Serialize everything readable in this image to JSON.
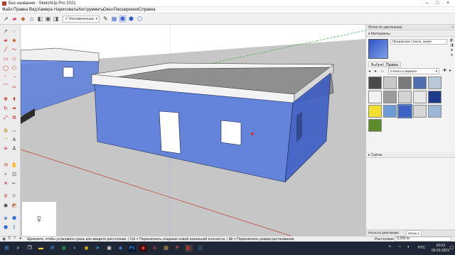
{
  "window": {
    "title": "Без названия - SketchUp Pro 2021",
    "controls": [
      "minimize-icon",
      "maximize-icon",
      "close-icon"
    ]
  },
  "menu": [
    "Файл",
    "Правка",
    "Вид",
    "Камера",
    "Нарисовать",
    "Инструменты",
    "Окно",
    "Расширения",
    "Справка"
  ],
  "toolbar": {
    "layer_label": "Непомеченные",
    "icons": [
      "select-icon",
      "eraser-icon",
      "paint-bucket-icon",
      "home-icon",
      "cube-icon",
      "box-front-icon",
      "box-right-icon",
      "box-back-icon",
      "box-left-icon",
      "pencil-icon",
      "xray-icon",
      "wireframe-icon",
      "shaded-icon",
      "textured-icon"
    ]
  },
  "left_tools": [
    "select-icon",
    "lasso-icon",
    "eraser-icon",
    "paint-bucket-icon",
    "line-icon",
    "freehand-icon",
    "rectangle-icon",
    "rotated-rectangle-icon",
    "circle-icon",
    "polygon-icon",
    "arc-icon",
    "pie-icon",
    "move-icon",
    "push-pull-icon",
    "rotate-icon",
    "follow-me-icon",
    "scale-icon",
    "offset-icon",
    "tape-measure-icon",
    "dimension-icon",
    "protractor-icon",
    "text-icon",
    "axes-icon",
    "3d-text-icon",
    "orbit-icon",
    "pan-icon",
    "zoom-icon",
    "zoom-window-icon",
    "zoom-extents-icon",
    "previous-view-icon",
    "position-camera-icon",
    "walk-icon",
    "look-around-icon",
    "section-plane-icon",
    "sandbox-icon",
    "warehouse-icon"
  ],
  "tray": {
    "title": "Лоток по умолчанию",
    "materials_panel": "Материалы",
    "material_name": "Прозрачное стекло, синее",
    "tabs": [
      "Выбрать",
      "Правка"
    ],
    "library": "Стекло и зеркала",
    "scenes_panel": "Сцены",
    "bottom_tabs": [
      "Лоток по умолчанию",
      "Лоток 1"
    ],
    "swatch_colors": [
      "#4a4a4a",
      "#c8c8c8",
      "#7a7a7a",
      "#4f6eae",
      "#b7c9d8",
      "#f2f2f2",
      "#9c9c9c",
      "#d4d4d4",
      "#e8e8e8",
      "#1e3a8a",
      "#f2e030",
      "#6f9bd6",
      "#3b62c4",
      "#d7d7d7",
      "#9cb6d8",
      "#5e8a2e"
    ]
  },
  "status": {
    "hint": "Щелкните, чтобы установить грань или введите расстояние. | Ctrl = Переключить создание новой начальной плоскости. | Alt = Переключить режим растягивания.",
    "measure_label": "Расстояние",
    "measure_value": "0,200 m"
  },
  "taskbar": {
    "apps": [
      "windows-icon",
      "search-icon",
      "task-view-icon",
      "file-explorer-icon",
      "mail-icon",
      "whatsapp-icon",
      "edge-icon",
      "chrome-icon",
      "telegram-icon",
      "store-icon",
      "photoshop-icon",
      "sketchup-icon",
      "autocad-icon",
      "files-icon",
      "powerpoint-icon",
      "layout-icon",
      "app-icon"
    ],
    "lang": "РУС",
    "time": "20:03",
    "date": "09.03.2023"
  },
  "colors": {
    "glass_blue": "#5b7fdc",
    "glass_dark": "#3f5fc4",
    "roof": "#8f8f8f",
    "parapet": "#f2f2f2",
    "sky": "#ffffff",
    "ground": "#c4c4c4",
    "axis_red": "#c0392b",
    "axis_green": "#3aaa3a"
  }
}
